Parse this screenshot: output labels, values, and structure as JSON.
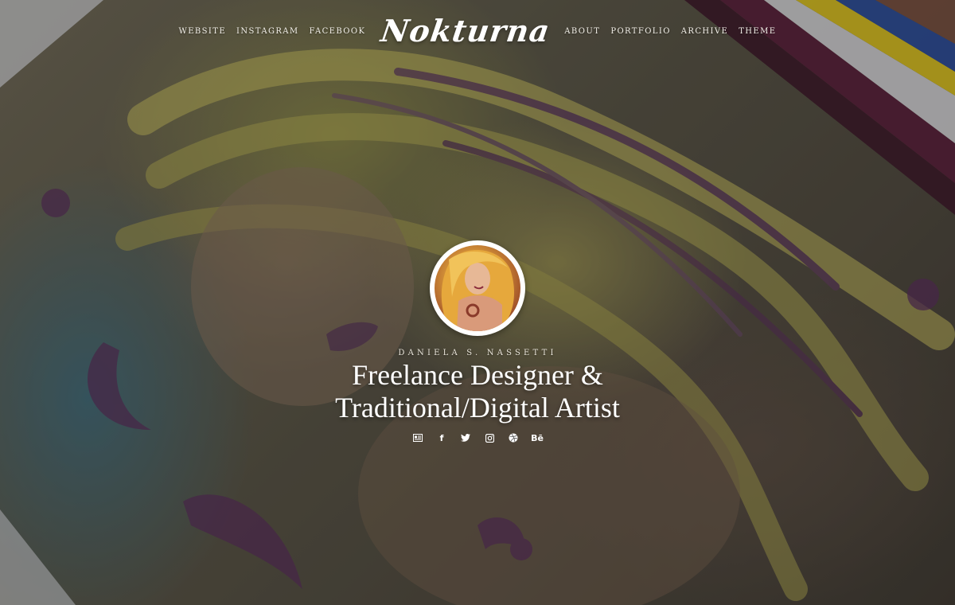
{
  "nav": {
    "left": [
      {
        "label": "WEBSITE"
      },
      {
        "label": "INSTAGRAM"
      },
      {
        "label": "FACEBOOK"
      }
    ],
    "logo": "Nokturna",
    "right": [
      {
        "label": "ABOUT"
      },
      {
        "label": "PORTFOLIO"
      },
      {
        "label": "ARCHIVE"
      },
      {
        "label": "THEME"
      }
    ]
  },
  "hero": {
    "author": "DANIELA S. NASSETTI",
    "headline_line1": "Freelance Designer &",
    "headline_line2": "Traditional/Digital Artist",
    "socials": [
      {
        "icon": "website-icon"
      },
      {
        "icon": "facebook-icon",
        "glyph": "f"
      },
      {
        "icon": "twitter-icon"
      },
      {
        "icon": "instagram-icon"
      },
      {
        "icon": "dribbble-icon"
      },
      {
        "icon": "behance-icon",
        "glyph": "Bē"
      }
    ]
  },
  "colors": {
    "text": "#ffffff",
    "hair": "#c4ba5a",
    "accent_purple": "#5a2f5e",
    "pencil_yellow": "#e2c820",
    "pencil_blue": "#2a4ea0",
    "pencil_purple": "#5a1f3c"
  }
}
